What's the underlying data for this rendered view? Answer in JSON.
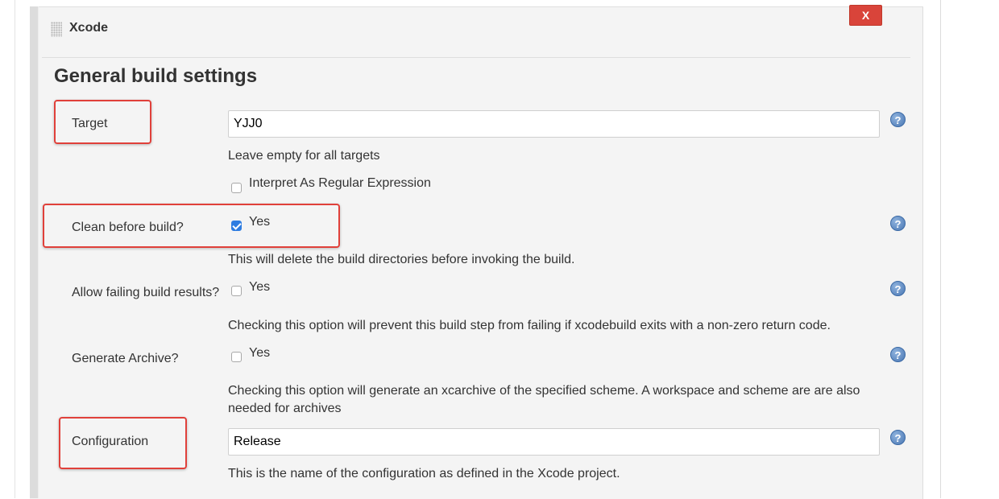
{
  "step": {
    "title": "Xcode",
    "delete_label": "X"
  },
  "section": {
    "title": "General build settings"
  },
  "help_glyph": "?",
  "fields": {
    "target": {
      "label": "Target",
      "value": "YJJ0",
      "description": "Leave empty for all targets",
      "regex_checkbox_label": "Interpret As Regular Expression",
      "regex_checked": false
    },
    "clean_before_build": {
      "label": "Clean before build?",
      "checkbox_label": "Yes",
      "checked": true,
      "description": "This will delete the build directories before invoking the build."
    },
    "allow_failing": {
      "label": "Allow failing build results?",
      "checkbox_label": "Yes",
      "checked": false,
      "description": "Checking this option will prevent this build step from failing if xcodebuild exits with a non-zero return code."
    },
    "generate_archive": {
      "label": "Generate Archive?",
      "checkbox_label": "Yes",
      "checked": false,
      "description": "Checking this option will generate an xcarchive of the specified scheme. A workspace and scheme are are also needed for archives"
    },
    "configuration": {
      "label": "Configuration",
      "value": "Release",
      "description": "This is the name of the configuration as defined in the Xcode project."
    }
  },
  "colors": {
    "highlight": "#e0403a",
    "delete_button": "#d9443a",
    "checkbox_checked": "#2f7de1",
    "panel_background": "#f4f4f4"
  }
}
